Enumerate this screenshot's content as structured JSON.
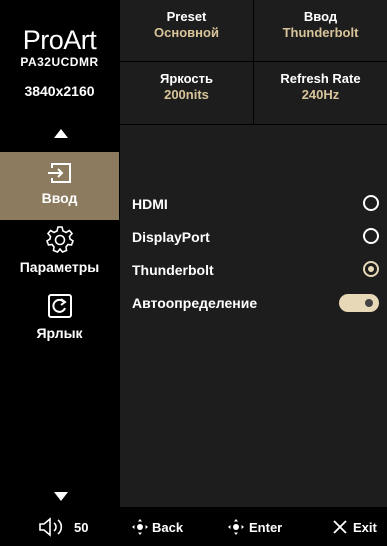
{
  "brand": "ProArt",
  "model": "PA32UCDMR",
  "resolution": "3840x2160",
  "status": [
    {
      "label": "Preset",
      "value": "Основной"
    },
    {
      "label": "Ввод",
      "value": "Thunderbolt"
    },
    {
      "label": "Яркость",
      "value": "200nits"
    },
    {
      "label": "Refresh Rate",
      "value": "240Hz"
    }
  ],
  "nav": [
    {
      "label": "Ввод",
      "icon": "input-icon",
      "active": true
    },
    {
      "label": "Параметры",
      "icon": "settings-icon",
      "active": false
    },
    {
      "label": "Ярлык",
      "icon": "shortcut-icon",
      "active": false
    }
  ],
  "options": [
    {
      "label": "HDMI",
      "control": "radio",
      "selected": false
    },
    {
      "label": "DisplayPort",
      "control": "radio",
      "selected": false
    },
    {
      "label": "Thunderbolt",
      "control": "radio",
      "selected": true
    },
    {
      "label": "Автоопределение",
      "control": "toggle",
      "on": true
    }
  ],
  "footer": {
    "volume": "50",
    "back": "Back",
    "enter": "Enter",
    "exit": "Exit"
  },
  "colors": {
    "accent": "#d8c49a",
    "active_nav": "#8c7b5e",
    "panel": "#1d1d1d"
  }
}
